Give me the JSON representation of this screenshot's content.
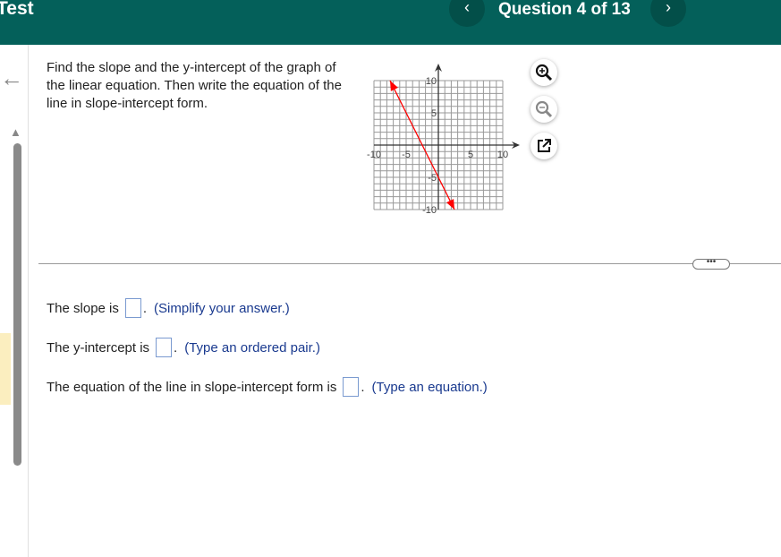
{
  "header": {
    "title": "Test",
    "question_label": "Question 4 of 13",
    "prev_icon": "chevron-left",
    "next_icon": "chevron-right",
    "color": "#04605a"
  },
  "question": {
    "text": "Find the slope and the y-intercept of the graph of the linear equation. Then write the equation of the line in slope-intercept form."
  },
  "chart_data": {
    "type": "line",
    "xlim": [
      -10,
      10
    ],
    "ylim": [
      -10,
      10
    ],
    "grid": true,
    "x_ticks": [
      "-10",
      "-5",
      "5",
      "10"
    ],
    "y_ticks": [
      "10",
      "5",
      "-5",
      "-10"
    ],
    "series": [
      {
        "points": [
          [
            -7.5,
            10
          ],
          [
            2.5,
            -10
          ]
        ],
        "color": "#ff0000",
        "arrows": "both"
      }
    ]
  },
  "tools": {
    "zoom_in": "zoom-in-icon",
    "zoom_out": "zoom-out-icon",
    "popout": "popout-icon"
  },
  "more_label": "•••",
  "answers": [
    {
      "prefix": "The slope is",
      "suffix": ".",
      "hint": "(Simplify your answer.)"
    },
    {
      "prefix": "The y-intercept is",
      "suffix": ".",
      "hint": "(Type an ordered pair.)"
    },
    {
      "prefix": "The equation of the line in slope-intercept form is",
      "suffix": ".",
      "hint": "(Type an equation.)"
    }
  ]
}
